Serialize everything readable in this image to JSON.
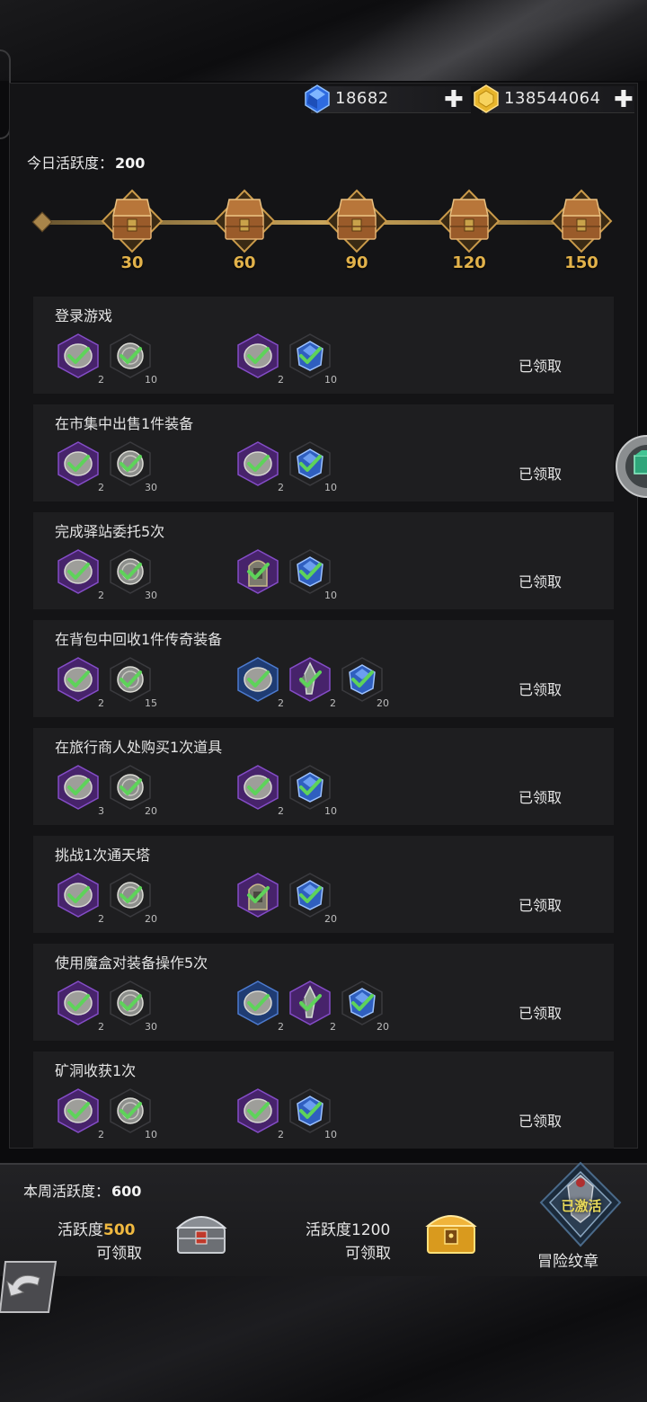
{
  "currency": {
    "gems": "18682",
    "gold": "138544064",
    "gem_icon": "blue-gem-icon",
    "gold_icon": "gold-coin-icon"
  },
  "daily": {
    "label": "今日活跃度：",
    "value": "200",
    "milestones": [
      "30",
      "60",
      "90",
      "120",
      "150"
    ]
  },
  "tasks": [
    {
      "title": "登录游戏",
      "status": "已领取",
      "left_items": [
        {
          "qty": "2",
          "icon": "stone-icon",
          "frame": "purple"
        },
        {
          "qty": "10",
          "icon": "coin-icon",
          "frame": "dark"
        }
      ],
      "right_items": [
        {
          "qty": "2",
          "icon": "stone-icon",
          "frame": "purple"
        },
        {
          "qty": "10",
          "icon": "blue-gem-icon",
          "frame": "dark"
        }
      ]
    },
    {
      "title": "在市集中出售1件装备",
      "status": "已领取",
      "left_items": [
        {
          "qty": "2",
          "icon": "stone-icon",
          "frame": "purple"
        },
        {
          "qty": "30",
          "icon": "coin-icon",
          "frame": "dark"
        }
      ],
      "right_items": [
        {
          "qty": "2",
          "icon": "stone-icon",
          "frame": "purple"
        },
        {
          "qty": "10",
          "icon": "blue-gem-icon",
          "frame": "dark"
        }
      ]
    },
    {
      "title": "完成驿站委托5次",
      "status": "已领取",
      "left_items": [
        {
          "qty": "2",
          "icon": "stone-icon",
          "frame": "purple"
        },
        {
          "qty": "30",
          "icon": "coin-icon",
          "frame": "dark"
        }
      ],
      "right_items": [
        {
          "qty": "",
          "icon": "tombstone-icon",
          "frame": "purple"
        },
        {
          "qty": "10",
          "icon": "blue-gem-icon",
          "frame": "dark"
        }
      ]
    },
    {
      "title": "在背包中回收1件传奇装备",
      "status": "已领取",
      "left_items": [
        {
          "qty": "2",
          "icon": "stone-icon",
          "frame": "purple"
        },
        {
          "qty": "15",
          "icon": "coin-icon",
          "frame": "dark"
        }
      ],
      "right_items": [
        {
          "qty": "2",
          "icon": "stone-icon",
          "frame": "blue"
        },
        {
          "qty": "2",
          "icon": "crystal-icon",
          "frame": "purple"
        },
        {
          "qty": "20",
          "icon": "blue-gem-icon",
          "frame": "dark"
        }
      ]
    },
    {
      "title": "在旅行商人处购买1次道具",
      "status": "已领取",
      "left_items": [
        {
          "qty": "3",
          "icon": "stone-icon",
          "frame": "purple"
        },
        {
          "qty": "20",
          "icon": "coin-icon",
          "frame": "dark"
        }
      ],
      "right_items": [
        {
          "qty": "2",
          "icon": "stone-icon",
          "frame": "purple"
        },
        {
          "qty": "10",
          "icon": "blue-gem-icon",
          "frame": "dark"
        }
      ]
    },
    {
      "title": "挑战1次通天塔",
      "status": "已领取",
      "left_items": [
        {
          "qty": "2",
          "icon": "stone-icon",
          "frame": "purple"
        },
        {
          "qty": "20",
          "icon": "coin-icon",
          "frame": "dark"
        }
      ],
      "right_items": [
        {
          "qty": "",
          "icon": "tombstone-icon",
          "frame": "purple"
        },
        {
          "qty": "20",
          "icon": "blue-gem-icon",
          "frame": "dark"
        }
      ]
    },
    {
      "title": "使用魔盒对装备操作5次",
      "status": "已领取",
      "left_items": [
        {
          "qty": "2",
          "icon": "stone-icon",
          "frame": "purple"
        },
        {
          "qty": "30",
          "icon": "coin-icon",
          "frame": "dark"
        }
      ],
      "right_items": [
        {
          "qty": "2",
          "icon": "stone-icon",
          "frame": "blue"
        },
        {
          "qty": "2",
          "icon": "crystal-icon",
          "frame": "purple"
        },
        {
          "qty": "20",
          "icon": "blue-gem-icon",
          "frame": "dark"
        }
      ]
    },
    {
      "title": "矿洞收获1次",
      "status": "已领取",
      "left_items": [
        {
          "qty": "2",
          "icon": "stone-icon",
          "frame": "purple"
        },
        {
          "qty": "10",
          "icon": "coin-icon",
          "frame": "dark"
        }
      ],
      "right_items": [
        {
          "qty": "2",
          "icon": "stone-icon",
          "frame": "purple"
        },
        {
          "qty": "10",
          "icon": "blue-gem-icon",
          "frame": "dark"
        }
      ]
    }
  ],
  "weekly": {
    "label": "本周活跃度：",
    "value": "600",
    "rewards": [
      {
        "prefix": "活跃度",
        "threshold": "500",
        "status": "可领取",
        "icon": "silver-chest-icon"
      },
      {
        "prefix": "活跃度",
        "threshold": "1200",
        "status": "可领取",
        "icon": "gold-chest-icon"
      }
    ],
    "badge_status": "已激活",
    "badge_label": "冒险纹章"
  },
  "colors": {
    "accent_gold": "#e2b24a",
    "highlight_orange": "#f0b940",
    "check_green": "#5ed35a",
    "purple_frame": "#5b2f86",
    "blue_frame": "#2b4b8a"
  }
}
